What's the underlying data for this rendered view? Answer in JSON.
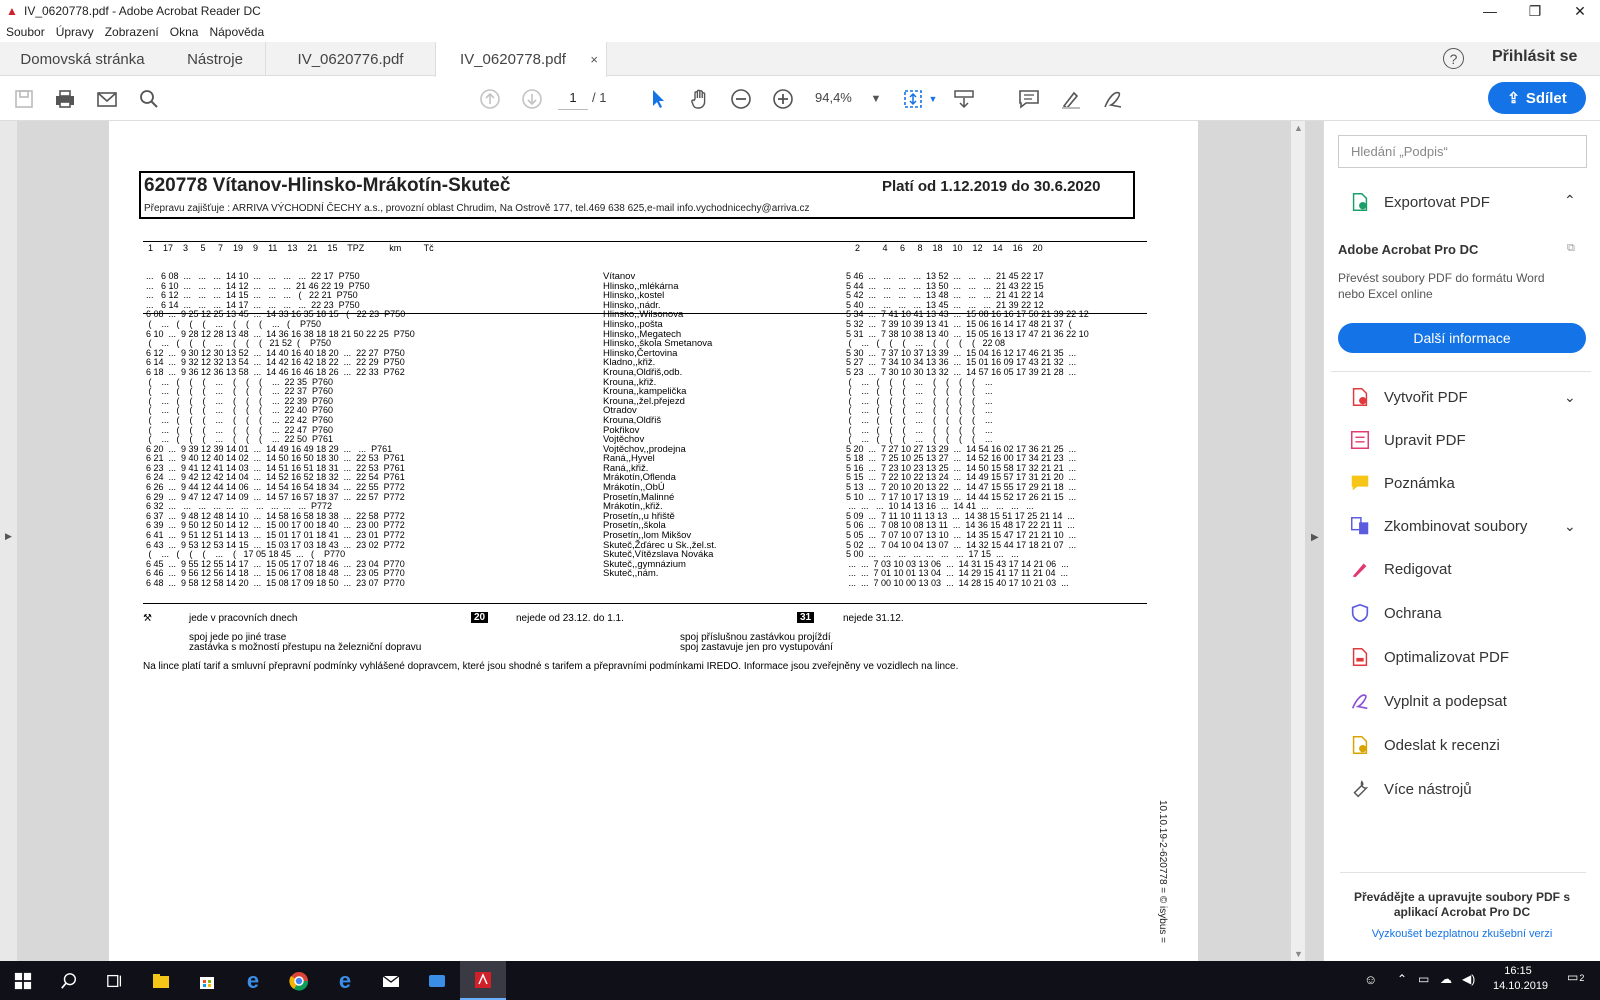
{
  "window": {
    "title": "IV_0620778.pdf - Adobe Acrobat Reader DC"
  },
  "menu": [
    "Soubor",
    "Úpravy",
    "Zobrazení",
    "Okna",
    "Nápověda"
  ],
  "tabs": {
    "home": "Domovská stránka",
    "tools": "Nástroje",
    "doc1": "IV_0620776.pdf",
    "doc2": "IV_0620778.pdf",
    "close": "×"
  },
  "account": {
    "help": "?",
    "signin": "Přihlásit se"
  },
  "toolbar": {
    "page_current": "1",
    "page_total": "/ 1",
    "zoom": "94,4%",
    "share": "Sdílet"
  },
  "sidebar": {
    "search_placeholder": "Hledání „Podpis“",
    "export": "Exportovat PDF",
    "promo_title": "Adobe Acrobat Pro DC",
    "promo_text": "Převést soubory PDF do formátu Word nebo Excel online",
    "promo_button": "Další informace",
    "tools": [
      "Vytvořit PDF",
      "Upravit PDF",
      "Poznámka",
      "Zkombinovat soubory",
      "Redigovat",
      "Ochrana",
      "Optimalizovat PDF",
      "Vyplnit a podepsat",
      "Odeslat k recenzi",
      "Více nástrojů"
    ],
    "footer_text": "Převádějte a upravujte soubory PDF s aplikací Acrobat Pro DC",
    "footer_link": "Vyzkoušet bezplatnou zkušební verzi"
  },
  "document": {
    "title": "620778  Vítanov-Hlinsko-Mrákotín-Skuteč",
    "valid": "Platí od 1.12.2019 do 30.6.2020",
    "carrier": "Přepravu zajišťuje   : ARRIVA VÝCHODNÍ ČECHY a.s., provozní oblast Chrudim, Na Ostrově 177, tel.469 638 625,e-mail info.vychodnicechy@arriva.cz",
    "col_header_left": "1    17    3     5     7    19    9    11    13    21    15    TPZ          km         Tč",
    "col_header_right": "2         4     6     8    18    10    12    14    16    20",
    "stops": [
      "Vítanov",
      "Hlinsko,,mlékárna",
      "Hlinsko,,kostel",
      "Hlinsko,,nádr.",
      "Hlinsko,,Wilsonova",
      "Hlinsko,,pošta",
      "Hlinsko,,Megatech",
      "Hlinsko,,škola Smetanova",
      "Hlinsko,Čertovina",
      "Kladno,,křiž.",
      "Krouna,Oldřiš,odb.",
      "Krouna,,křiž.",
      "Krouna,,kampelička",
      "Krouna,,žel.přejezd",
      "Otradov",
      "Krouna,Oldřiš",
      "Pokřikov",
      "Vojtěchov",
      "Vojtěchov,,prodejna",
      "Raná,,Hyvel",
      "Raná,,křiž.",
      "Mrákotín,Oflenda",
      "Mrákotín,,ObÚ",
      "Prosetín,Malinné",
      "Mrákotín,,křiž.",
      "Prosetín,,u hřiště",
      "Prosetín,,škola",
      "Prosetín,,lom Mikšov",
      "Skuteč,Žďárec u Sk.,žel.st.",
      "Skuteč,Vítězslava Nováka",
      "Skuteč,,gymnázium",
      "Skuteč,,nám."
    ],
    "left_times": [
      "...   6 08  ...   ...   ...  14 10  ...   ...   ...   ...  22 17  P750",
      "...   6 10  ...   ...   ...  14 12  ...   ...   ...  21 46 22 19  P750",
      "...   6 12  ...   ...   ...  14 15  ...   ...   ...   (   22 21  P750",
      "...   6 14  ...   ...   ...  14 17  ...   ...   ...   ...  22 23  P750",
      "6 08  ...  9 25 12 25 13 45  ...  14 33 16 35 18 15   (   22 23  P750",
      " (    ...   (    (    (    ...    (    (    (    ...   (    P750",
      "6 10  ...  9 28 12 28 13 48  ...  14 36 16 38 18 18 21 50 22 25  P750",
      " (    ...   (    (    (    ...    (    (    (   21 52  (    P750",
      "6 12  ...  9 30 12 30 13 52  ...  14 40 16 40 18 20  ...  22 27  P750",
      "6 14  ...  9 32 12 32 13 54  ...  14 42 16 42 18 22  ...  22 29  P750",
      "6 18  ...  9 36 12 36 13 58  ...  14 46 16 46 18 26  ...  22 33  P762",
      " (    ...   (    (    (    ...    (    (    (    ...  22 35  P760",
      " (    ...   (    (    (    ...    (    (    (    ...  22 37  P760",
      " (    ...   (    (    (    ...    (    (    (    ...  22 39  P760",
      " (    ...   (    (    (    ...    (    (    (    ...  22 40  P760",
      " (    ...   (    (    (    ...    (    (    (    ...  22 42  P760",
      " (    ...   (    (    (    ...    (    (    (    ...  22 47  P760",
      " (    ...   (    (    (    ...    (    (    (    ...  22 50  P761",
      "6 20  ...  9 39 12 39 14 01  ...  14 49 16 49 18 29  ...   ...  P761",
      "6 21  ...  9 40 12 40 14 02  ...  14 50 16 50 18 30  ...  22 53  P761",
      "6 23  ...  9 41 12 41 14 03  ...  14 51 16 51 18 31  ...  22 53  P761",
      "6 24  ...  9 42 12 42 14 04  ...  14 52 16 52 18 32  ...  22 54  P761",
      "6 26  ...  9 44 12 44 14 06  ...  14 54 16 54 18 34  ...  22 55  P772",
      "6 29  ...  9 47 12 47 14 09  ...  14 57 16 57 18 37  ...  22 57  P772",
      "6 32  ...   ...   ...   ...  ...   ...   ...   ...  ...   ...  P772",
      "6 37  ...  9 48 12 48 14 10  ...  14 58 16 58 18 38  ...  22 58  P772",
      "6 39  ...  9 50 12 50 14 12  ...  15 00 17 00 18 40  ...  23 00  P772",
      "6 41  ...  9 51 12 51 14 13  ...  15 01 17 01 18 41  ...  23 01  P772",
      "6 43  ...  9 53 12 53 14 15  ...  15 03 17 03 18 43  ...  23 02  P772",
      " (    ...   (    (    (    ...    (   17 05 18 45  ...   (    P770",
      "6 45  ...  9 55 12 55 14 17  ...  15 05 17 07 18 46  ...  23 04  P770",
      "6 46  ...  9 56 12 56 14 18  ...  15 06 17 08 18 48  ...  23 05  P770",
      "6 48  ...  9 58 12 58 14 20  ...  15 08 17 09 18 50  ...  23 07  P770"
    ],
    "right_times": [
      "5 46  ...   ...   ...   ...  13 52  ...   ...   ...  21 45 22 17",
      "5 44  ...   ...   ...   ...  13 50  ...   ...   ...  21 43 22 15",
      "5 42  ...   ...   ...   ...  13 48  ...   ...   ...  21 41 22 14",
      "5 40  ...   ...   ...   ...  13 45  ...   ...   ...  21 39 22 12",
      "5 34  ...  7 41 10 41 13 43  ...  15 08 16 16 17 50 21 39 22 12",
      "5 32  ...  7 39 10 39 13 41  ...  15 06 16 14 17 48 21 37  (",
      "5 31  ...  7 38 10 38 13 40  ...  15 05 16 13 17 47 21 36 22 10",
      " (    ...   (    (    (    ...    (    (    (    (   22 08",
      "5 30  ...  7 37 10 37 13 39  ...  15 04 16 12 17 46 21 35  ...",
      "5 27  ...  7 34 10 34 13 36  ...  15 01 16 09 17 43 21 32  ...",
      "5 23  ...  7 30 10 30 13 32  ...  14 57 16 05 17 39 21 28  ...",
      " (    ...   (    (    (    ...    (    (    (    (    ...",
      " (    ...   (    (    (    ...    (    (    (    (    ...",
      " (    ...   (    (    (    ...    (    (    (    (    ...",
      " (    ...   (    (    (    ...    (    (    (    (    ...",
      " (    ...   (    (    (    ...    (    (    (    (    ...",
      " (    ...   (    (    (    ...    (    (    (    (    ...",
      " (    ...   (    (    (    ...    (    (    (    (    ...",
      "5 20  ...  7 27 10 27 13 29  ...  14 54 16 02 17 36 21 25  ...",
      "5 18  ...  7 25 10 25 13 27  ...  14 52 16 00 17 34 21 23  ...",
      "5 16  ...  7 23 10 23 13 25  ...  14 50 15 58 17 32 21 21  ...",
      "5 15  ...  7 22 10 22 13 24  ...  14 49 15 57 17 31 21 20  ...",
      "5 13  ...  7 20 10 20 13 22  ...  14 47 15 55 17 29 21 18  ...",
      "5 10  ...  7 17 10 17 13 19  ...  14 44 15 52 17 26 21 15  ...",
      " ...  ...   ...  10 14 13 16  ...  14 41  ...   ...   ...   ...",
      "5 09  ...  7 11 10 11 13 13  ...  14 38 15 51 17 25 21 14  ...",
      "5 06  ...  7 08 10 08 13 11  ...  14 36 15 48 17 22 21 11  ...",
      "5 05  ...  7 07 10 07 13 10  ...  14 35 15 47 17 21 21 10  ...",
      "5 02  ...  7 04 10 04 13 07  ...  14 32 15 44 17 18 21 07  ...",
      "5 00  ...   ...   ...   ...  ...   ...   ...  17 15  ...   ...",
      " ...  ...  7 03 10 03 13 06  ...  14 31 15 43 17 14 21 06  ...",
      " ...  ...  7 01 10 01 13 04  ...  14 29 15 41 17 11 21 04  ...",
      " ...  ...  7 00 10 00 13 03  ...  14 28 15 40 17 10 21 03  ..."
    ],
    "legend": {
      "work_days": "jede v pracovních dnech",
      "n20": "20",
      "not_20": "nejede od 23.12. do 1.1.",
      "n31": "31",
      "not_31": "nejede 31.12.",
      "other_route": "spoj jede po jiné trase",
      "rail_transfer": "zastávka s možností přestupu na železniční dopravu",
      "passes": "spoj příslušnou zastávkou projíždí",
      "alight_only": "spoj zastavuje jen pro vystupování",
      "tariff": "Na lince platí tarif a smluvní přepravní podmínky vyhlášené dopravcem, které jsou shodné s tarifem a přepravními podmínkami IREDO. Informace jsou zveřejněny ve vozidlech na lince.",
      "code": "10.10.19-2-620778 = © isybus ="
    }
  },
  "taskbar": {
    "time": "16:15",
    "date": "14.10.2019",
    "notif": "2"
  }
}
